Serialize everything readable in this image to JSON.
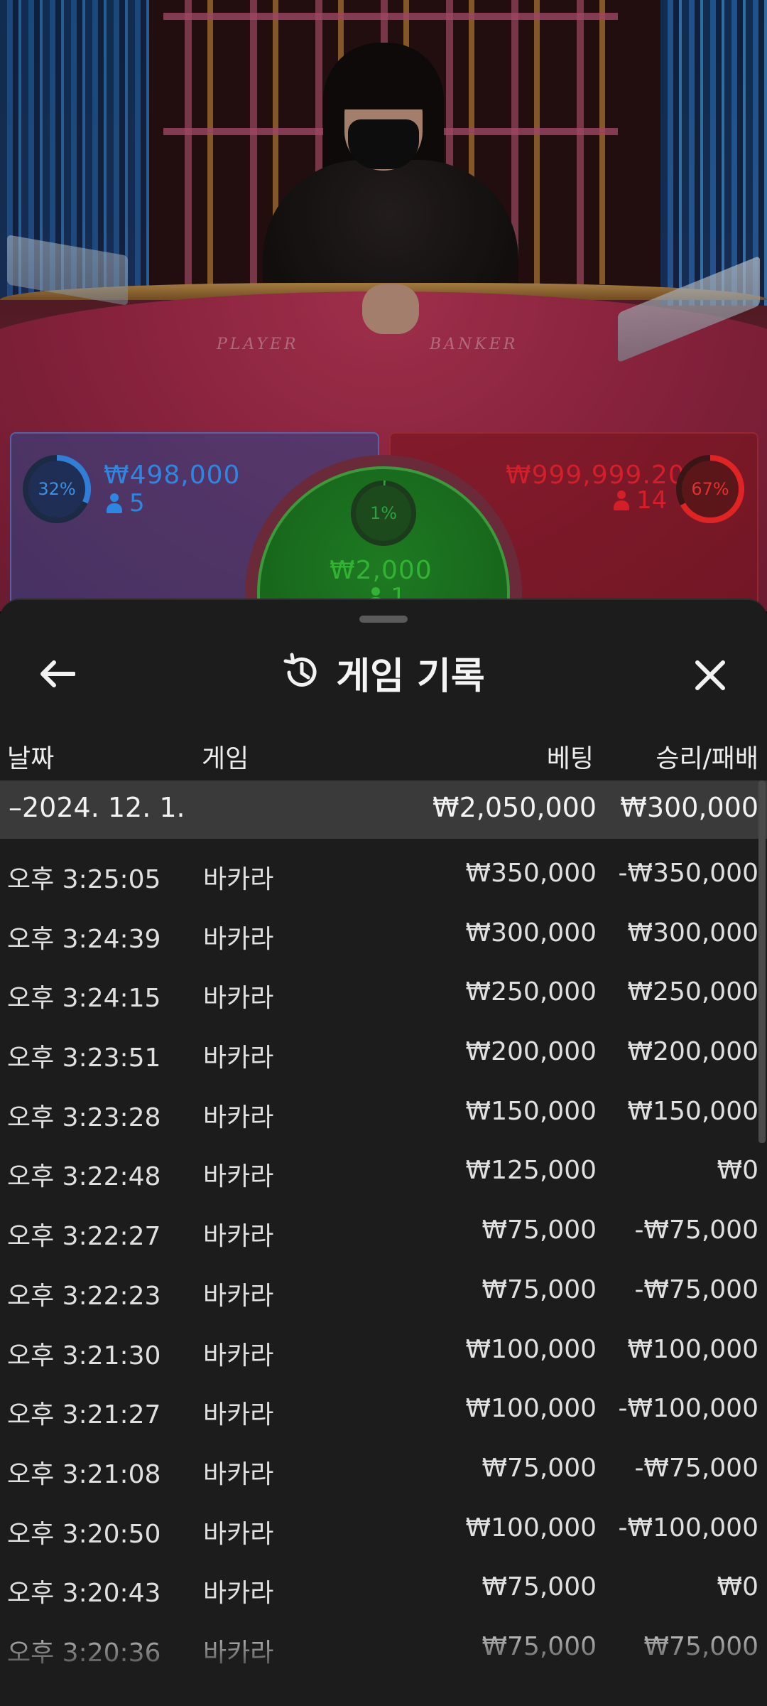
{
  "scene": {
    "player_label": "PLAYER",
    "banker_label": "BANKER"
  },
  "bets": {
    "player": {
      "percent": "32%",
      "amount": "₩498,000",
      "count": "5",
      "color": "#2f86e0"
    },
    "banker": {
      "percent": "67%",
      "amount": "₩999,999.20",
      "count": "14",
      "color": "#d21f2a"
    },
    "tie": {
      "percent": "1%",
      "amount": "₩2,000",
      "count": "1",
      "color": "#33b233"
    }
  },
  "sheet": {
    "title": "게임 기록",
    "icons": {
      "back": "arrow-left-icon",
      "history": "history-icon",
      "close": "close-icon"
    },
    "columns": {
      "date": "날짜",
      "game": "게임",
      "bet": "베팅",
      "result": "승리/패배"
    },
    "group": {
      "date": "–2024. 12. 1.",
      "bet": "₩2,050,000",
      "result": "₩300,000"
    },
    "rows": [
      {
        "time": "오후 3:25:05",
        "game": "바카라",
        "bet": "₩350,000",
        "result": "-₩350,000"
      },
      {
        "time": "오후 3:24:39",
        "game": "바카라",
        "bet": "₩300,000",
        "result": "₩300,000"
      },
      {
        "time": "오후 3:24:15",
        "game": "바카라",
        "bet": "₩250,000",
        "result": "₩250,000"
      },
      {
        "time": "오후 3:23:51",
        "game": "바카라",
        "bet": "₩200,000",
        "result": "₩200,000"
      },
      {
        "time": "오후 3:23:28",
        "game": "바카라",
        "bet": "₩150,000",
        "result": "₩150,000"
      },
      {
        "time": "오후 3:22:48",
        "game": "바카라",
        "bet": "₩125,000",
        "result": "₩0"
      },
      {
        "time": "오후 3:22:27",
        "game": "바카라",
        "bet": "₩75,000",
        "result": "-₩75,000"
      },
      {
        "time": "오후 3:22:23",
        "game": "바카라",
        "bet": "₩75,000",
        "result": "-₩75,000"
      },
      {
        "time": "오후 3:21:30",
        "game": "바카라",
        "bet": "₩100,000",
        "result": "₩100,000"
      },
      {
        "time": "오후 3:21:27",
        "game": "바카라",
        "bet": "₩100,000",
        "result": "-₩100,000"
      },
      {
        "time": "오후 3:21:08",
        "game": "바카라",
        "bet": "₩75,000",
        "result": "-₩75,000"
      },
      {
        "time": "오후 3:20:50",
        "game": "바카라",
        "bet": "₩100,000",
        "result": "-₩100,000"
      },
      {
        "time": "오후 3:20:43",
        "game": "바카라",
        "bet": "₩75,000",
        "result": "₩0"
      },
      {
        "time": "오후 3:20:36",
        "game": "바카라",
        "bet": "₩75,000",
        "result": "₩75,000"
      }
    ]
  }
}
